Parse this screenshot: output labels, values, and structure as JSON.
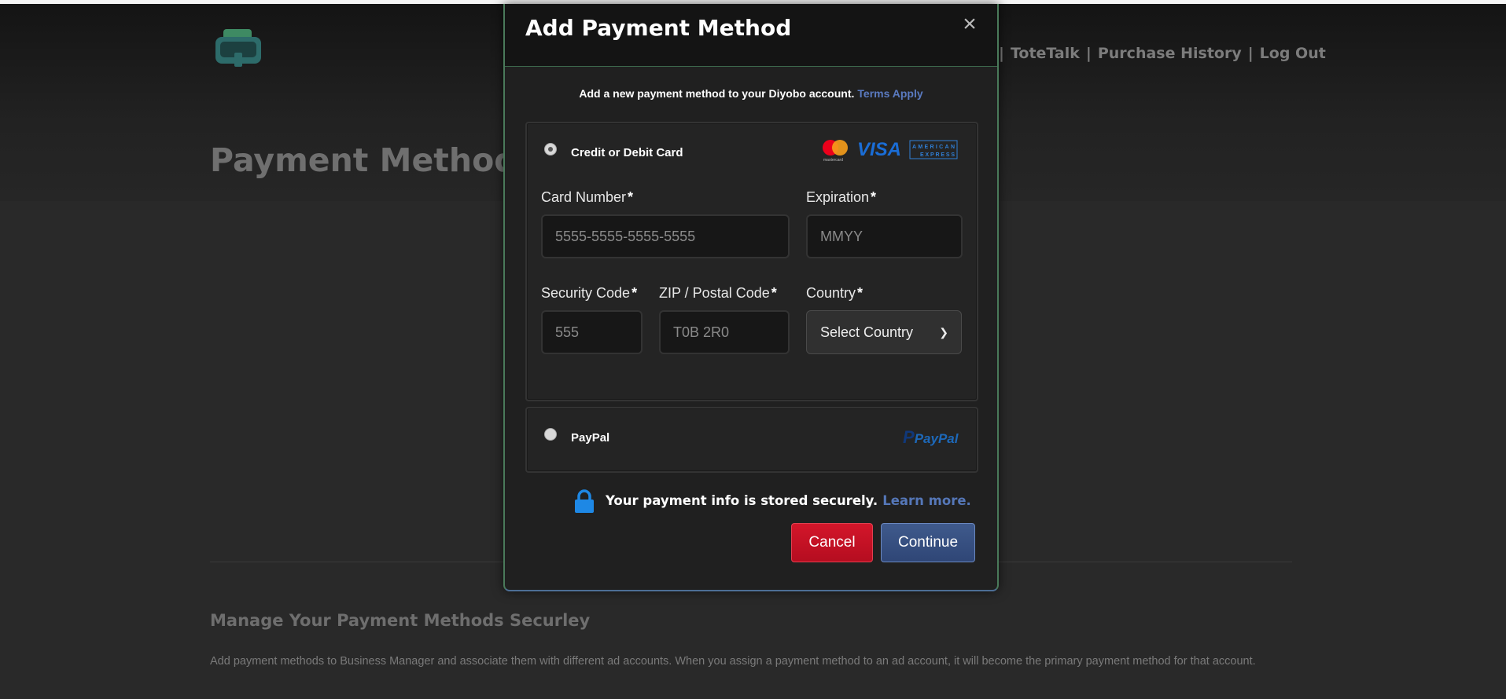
{
  "header": {
    "logo_name": "tote-logo",
    "nav": [
      {
        "label": "ToteTalk"
      },
      {
        "label": "Purchase History"
      },
      {
        "label": "Log Out"
      }
    ],
    "nav_separator": "|"
  },
  "page": {
    "title": "Payment Methods",
    "manage_title": "Manage Your Payment Methods Securley",
    "manage_desc": "Add payment methods to Business Manager and associate them with different ad accounts. When you assign a payment method to an ad account, it will become the primary payment method for that account."
  },
  "modal": {
    "title": "Add Payment Method",
    "close_label": "×",
    "intro": "Add a new payment method to your Diyobo account.",
    "terms_link": "Terms Apply",
    "card_option": {
      "label": "Credit or Debit Card",
      "selected": true,
      "brands": [
        "mastercard",
        "VISA",
        "AMERICAN EXPRESS"
      ],
      "card_number": {
        "label": "Card Number",
        "required_mark": "*",
        "placeholder": "5555-5555-5555-5555"
      },
      "expiration": {
        "label": "Expiration",
        "required_mark": "*",
        "placeholder": "MMYY"
      },
      "security_code": {
        "label": "Security Code",
        "required_mark": "*",
        "placeholder": "555"
      },
      "postal_code": {
        "label": "ZIP / Postal Code",
        "required_mark": "*",
        "placeholder": "T0B 2R0"
      },
      "country": {
        "label": "Country",
        "required_mark": "*",
        "value": "Select Country"
      }
    },
    "paypal_option": {
      "label": "PayPal",
      "selected": false,
      "logo_text_1": "Pay",
      "logo_text_2": "Pal"
    },
    "secure_text": "Your payment info is stored securely.",
    "learn_more": "Learn more.",
    "cancel_label": "Cancel",
    "continue_label": "Continue"
  },
  "colors": {
    "background": "#292929",
    "modal_background": "#202020",
    "cancel_button": "#c8102e",
    "continue_button": "#364f80",
    "link": "#5a7ac0",
    "lock_icon": "#1e88e5"
  }
}
